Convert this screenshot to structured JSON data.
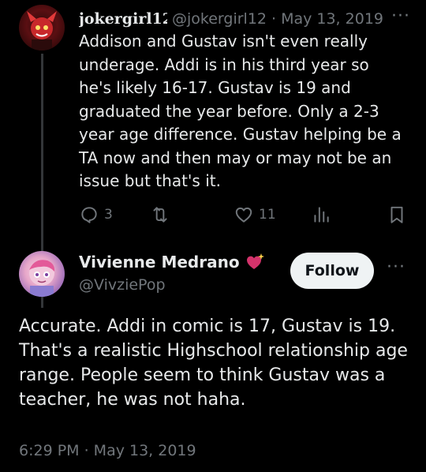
{
  "reply": {
    "display_name": "jokergirl12",
    "handle": "@jokergirl12",
    "separator": "·",
    "date": "May 13, 2019",
    "more": "···",
    "text": "Addison and Gustav isn't even really underage. Addi is in his third year so he's likely 16-17. Gustav is 19 and graduated the year before. Only a 2-3 year age difference. Gustav helping be a TA now and then may or may not be an issue but that's it.",
    "actions": {
      "reply_count": "3",
      "retweet_count": "",
      "like_count": "11"
    }
  },
  "main": {
    "display_name": "Vivienne Medrano",
    "handle": "@VivziePop",
    "follow_label": "Follow",
    "more": "···",
    "text": "Accurate. Addi in comic is 17, Gustav is 19. That's a realistic Highschool relationship age range. People seem to think Gustav was a teacher, he was not haha.",
    "timestamp": "6:29 PM · May 13, 2019"
  },
  "colors": {
    "background": "#000000",
    "text": "#e7e9ea",
    "muted": "#71767b",
    "follow_bg": "#eff3f4",
    "heart_emoji": "#d4336b"
  },
  "icons": [
    "reply-icon",
    "retweet-icon",
    "like-icon",
    "views-icon",
    "bookmark-icon",
    "sparkling-heart-icon"
  ]
}
